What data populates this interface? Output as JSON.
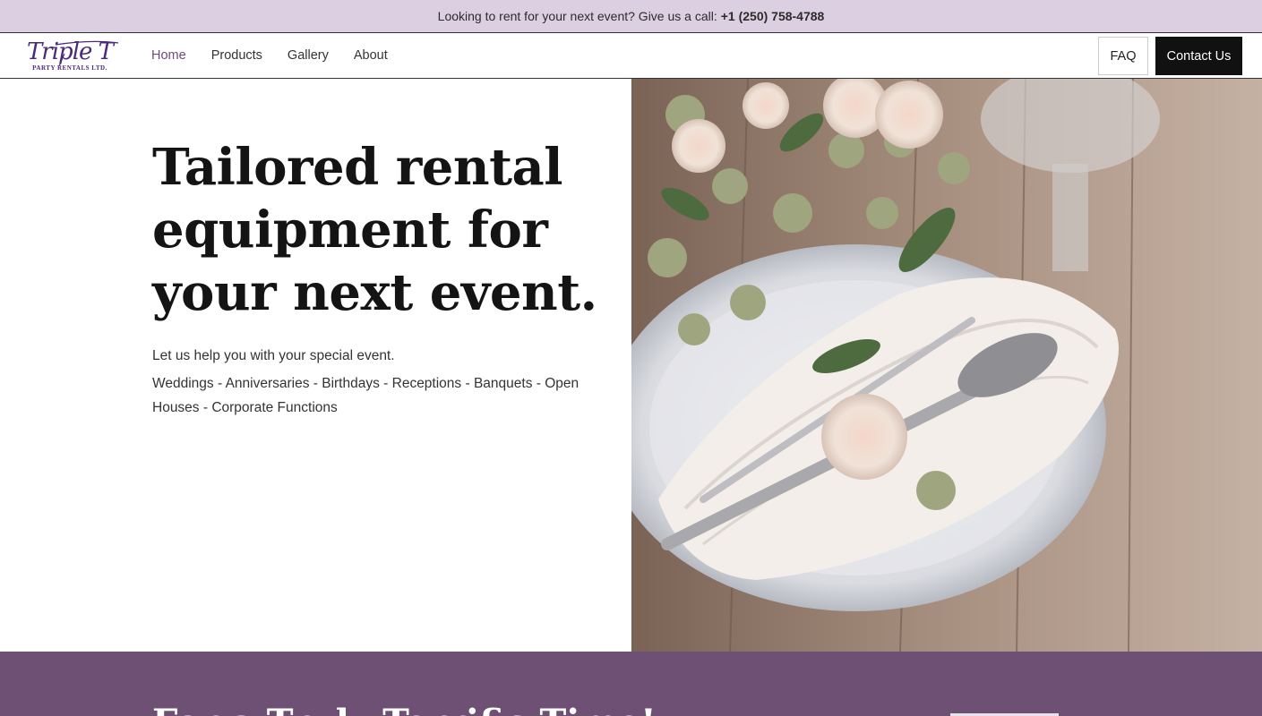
{
  "topbar": {
    "message": "Looking to rent for your next event? Give us a call:",
    "phone": "+1 (250) 758-4788"
  },
  "logo": {
    "script": "Triple T",
    "subtitle": "PARTY RENTALS LTD."
  },
  "nav": {
    "items": [
      {
        "label": "Home",
        "active": true
      },
      {
        "label": "Products",
        "active": false
      },
      {
        "label": "Gallery",
        "active": false
      },
      {
        "label": "About",
        "active": false
      }
    ],
    "faq_label": "FAQ",
    "contact_label": "Contact Us"
  },
  "hero": {
    "title": "Tailored rental equipment for your next event.",
    "lead": "Let us help you with your special event.",
    "events": "Weddings - Anniversaries - Birthdays - Receptions - Banquets - Open Houses - Corporate Functions",
    "image": "table-setting-with-roses-photo"
  },
  "band": {
    "title": "For a Truly Terrific Time!"
  },
  "colors": {
    "topbar_bg": "#dccfe1",
    "brand_purple": "#6e5075",
    "active_nav": "#6c4a82",
    "contact_bg": "#111111"
  }
}
